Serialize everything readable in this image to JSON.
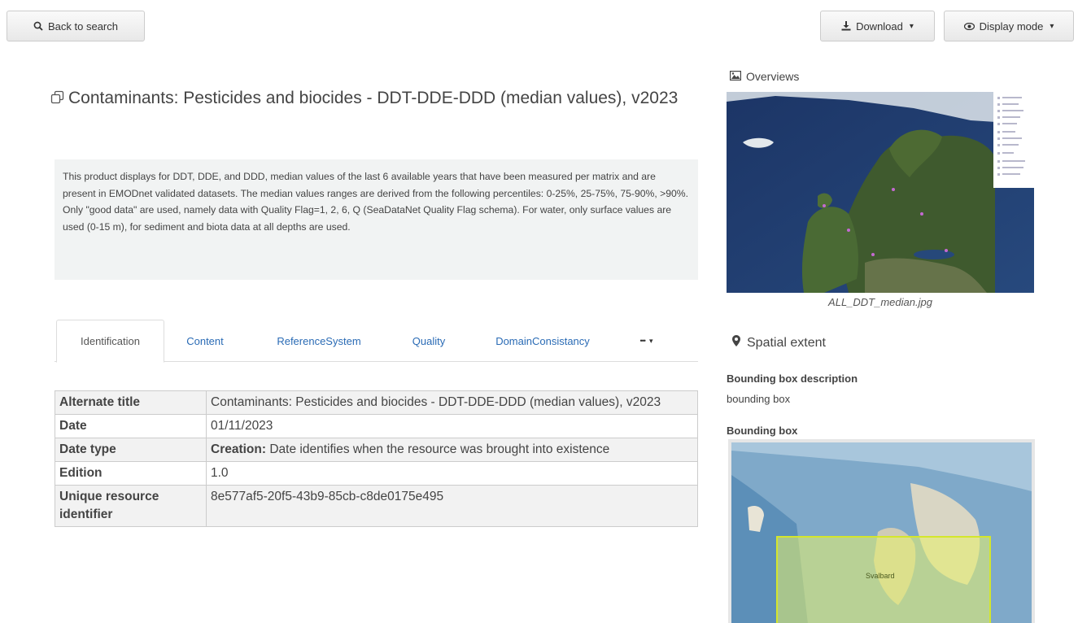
{
  "toolbar": {
    "back_label": "Back to search",
    "download_label": "Download",
    "display_mode_label": "Display mode"
  },
  "record": {
    "title": "Contaminants: Pesticides and biocides - DDT-DDE-DDD (median values), v2023",
    "abstract": "This product displays for DDT, DDE, and DDD, median values of the last 6 available years that have been measured per matrix and are present in EMODnet validated datasets. The median values ranges are derived from the following percentiles: 0-25%, 25-75%, 75-90%, >90%. Only \"good data\" are used, namely data with Quality Flag=1, 2, 6, Q (SeaDataNet Quality Flag schema). For water, only surface values are used (0-15 m), for sediment and biota data at all depths are used."
  },
  "tabs": [
    {
      "label": "Identification",
      "active": true
    },
    {
      "label": "Content"
    },
    {
      "label": "ReferenceSystem"
    },
    {
      "label": "Quality"
    },
    {
      "label": "DomainConsistancy"
    },
    {
      "label": "•••"
    }
  ],
  "identification": {
    "rows": [
      {
        "key": "Alternate title",
        "value": "Contaminants: Pesticides and biocides - DDT-DDE-DDD (median values), v2023"
      },
      {
        "key": "Date",
        "value": "01/11/2023"
      },
      {
        "key": "Date type",
        "value_bold": "Creation:",
        "value": " Date identifies when the resource was brought into existence"
      },
      {
        "key": "Edition",
        "value": "1.0"
      },
      {
        "key": "Unique resource identifier",
        "value": "8e577af5-20f5-43b9-85cb-c8de0175e495"
      }
    ]
  },
  "sidebar": {
    "overviews_heading": "Overviews",
    "overview_caption": "ALL_DDT_median.jpg",
    "spatial_heading": "Spatial extent",
    "bbox_description_label": "Bounding box description",
    "bbox_description_value": "bounding box",
    "bbox_label": "Bounding box",
    "bbox_place_label": "Svalbard"
  },
  "colors": {
    "link": "#2a6bb5",
    "abstract_bg": "#f1f3f3",
    "bbox_fill": "#e8f26a",
    "sea_dark": "#1f3a6e"
  },
  "icons": [
    "search-icon",
    "download-icon",
    "eye-icon",
    "copy-icon",
    "image-icon",
    "map-marker-icon"
  ]
}
